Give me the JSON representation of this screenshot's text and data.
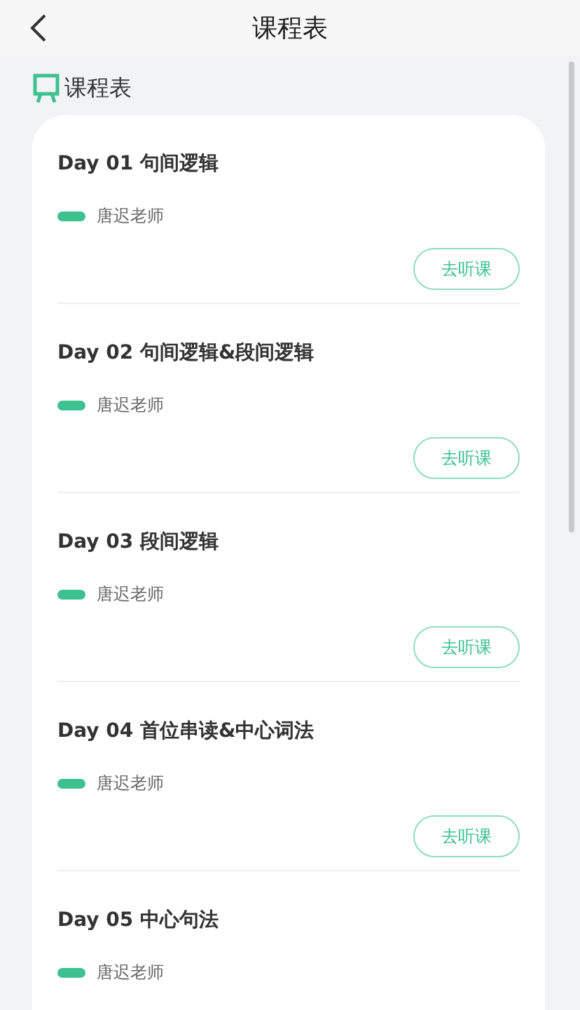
{
  "header": {
    "title": "课程表"
  },
  "section": {
    "title": "课程表"
  },
  "courses": [
    {
      "title": "Day 01 句间逻辑",
      "teacher": "唐迟老师",
      "button": "去听课"
    },
    {
      "title": "Day 02 句间逻辑&段间逻辑",
      "teacher": "唐迟老师",
      "button": "去听课"
    },
    {
      "title": "Day 03 段间逻辑",
      "teacher": "唐迟老师",
      "button": "去听课"
    },
    {
      "title": "Day 04 首位串读&中心词法",
      "teacher": "唐迟老师",
      "button": "去听课"
    },
    {
      "title": "Day 05 中心句法",
      "teacher": "唐迟老师"
    }
  ]
}
